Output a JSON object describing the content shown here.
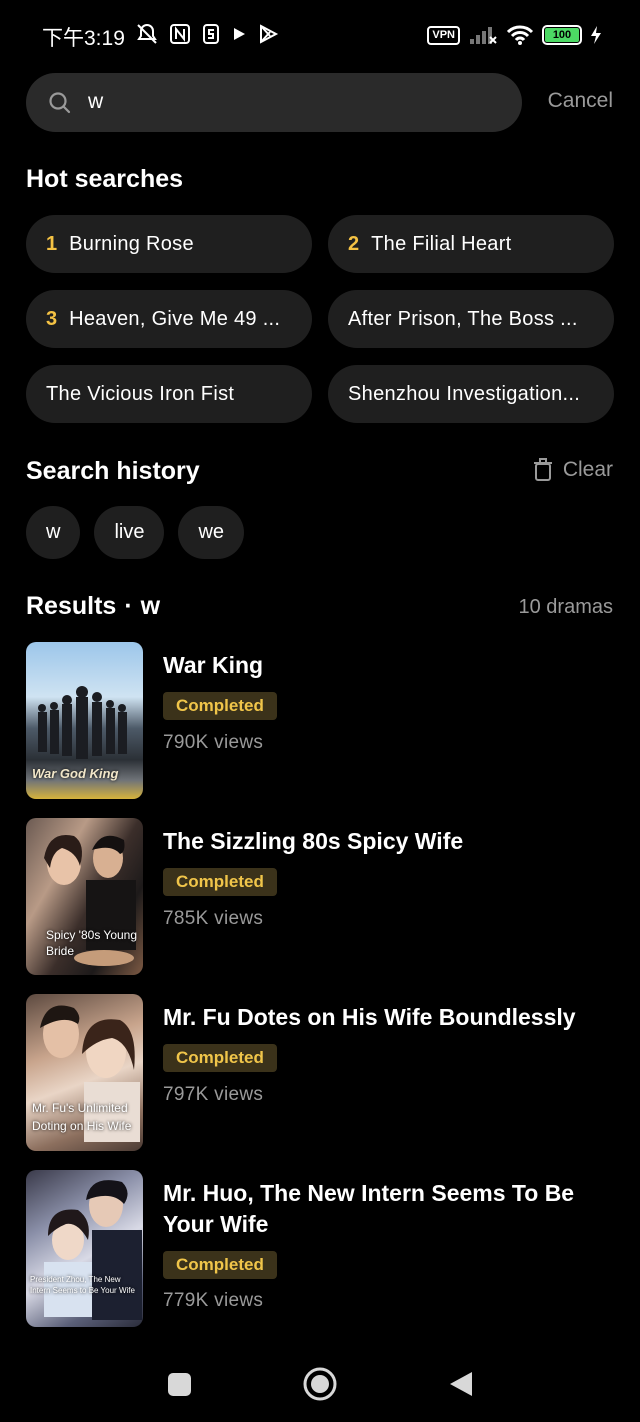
{
  "status_bar": {
    "time": "下午3:19",
    "vpn": "VPN",
    "battery": "100"
  },
  "search": {
    "query": "w",
    "cancel": "Cancel"
  },
  "hot_searches": {
    "title": "Hot searches",
    "items": [
      {
        "rank": "1",
        "label": "Burning Rose"
      },
      {
        "rank": "2",
        "label": "The Filial Heart"
      },
      {
        "rank": "3",
        "label": "Heaven, Give Me 49 ..."
      },
      {
        "rank": "",
        "label": "After Prison, The Boss ..."
      },
      {
        "rank": "",
        "label": "The Vicious Iron Fist"
      },
      {
        "rank": "",
        "label": "Shenzhou Investigation..."
      }
    ]
  },
  "history": {
    "title": "Search history",
    "clear": "Clear",
    "items": [
      "w",
      "live",
      "we"
    ]
  },
  "results": {
    "title": "Results",
    "separator": "·",
    "query": "w",
    "count": "10 dramas",
    "items": [
      {
        "title": "War King",
        "status": "Completed",
        "views": "790K views",
        "poster_caption": "War God King"
      },
      {
        "title": "The Sizzling 80s Spicy Wife",
        "status": "Completed",
        "views": "785K views",
        "poster_caption": "Spicy '80s Young Bride"
      },
      {
        "title": "Mr. Fu Dotes on His Wife Boundlessly",
        "status": "Completed",
        "views": "797K views",
        "poster_caption": "Mr. Fu's Unlimited Doting on His Wife"
      },
      {
        "title": "Mr. Huo, The New Intern Seems To Be Your Wife",
        "status": "Completed",
        "views": "779K views",
        "poster_caption": "President Zhou, The New Intern Seems to Be Your Wife"
      }
    ]
  },
  "colors": {
    "accent": "#f4c244",
    "badge_bg": "#3b321a",
    "chip_bg": "#1f1f1f",
    "muted": "#9a9a9a"
  }
}
